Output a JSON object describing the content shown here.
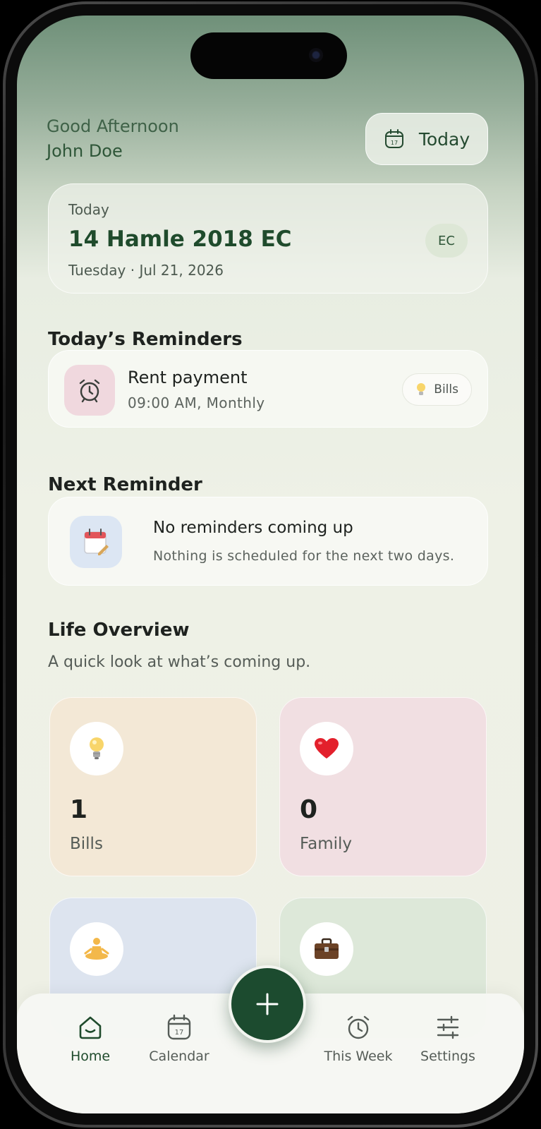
{
  "header": {
    "greeting": "Good Afternoon",
    "user_name": "John Doe",
    "today_button": "Today",
    "calendar_icon_day": "17"
  },
  "date_card": {
    "label": "Today",
    "ethiopian_date": "14 Hamle 2018 EC",
    "gregorian_date": "Tuesday · Jul 21, 2026",
    "badge": "EC"
  },
  "todays_reminders": {
    "title": "Today’s Reminders",
    "items": [
      {
        "title": "Rent payment",
        "subtitle": "09:00 AM, Monthly",
        "category": "Bills",
        "icon": "alarm-clock-icon"
      }
    ]
  },
  "next_reminder": {
    "title": "Next Reminder",
    "empty_title": "No reminders coming up",
    "empty_subtitle": "Nothing is scheduled for the next two days."
  },
  "life_overview": {
    "title": "Life Overview",
    "subtitle": "A quick look at what’s coming up.",
    "tiles": [
      {
        "icon": "lightbulb-icon",
        "count": "1",
        "name": "Bills"
      },
      {
        "icon": "heart-icon",
        "count": "0",
        "name": "Family"
      },
      {
        "icon": "meditation-icon"
      },
      {
        "icon": "briefcase-icon"
      }
    ]
  },
  "tabbar": {
    "items": [
      {
        "label": "Home",
        "icon": "home-icon",
        "active": true
      },
      {
        "label": "Calendar",
        "icon": "calendar-icon"
      },
      {
        "label": "This Week",
        "icon": "alarm-clock-icon"
      },
      {
        "label": "Settings",
        "icon": "sliders-icon"
      }
    ],
    "add_button_icon": "plus-icon"
  },
  "colors": {
    "accent": "#1c4b2f",
    "bills_tile": "#f3e8d6",
    "family_tile": "#f1dfe2",
    "health_tile": "#dde4ef",
    "work_tile": "#dde8d9"
  }
}
